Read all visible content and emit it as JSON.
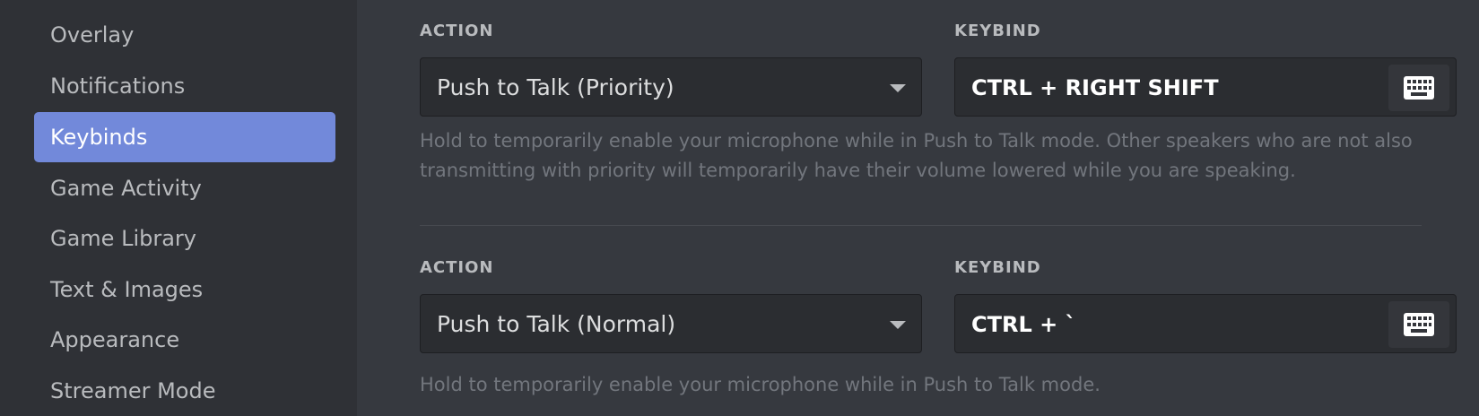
{
  "sidebar": {
    "items": [
      {
        "label": "Overlay",
        "active": false
      },
      {
        "label": "Notifications",
        "active": false
      },
      {
        "label": "Keybinds",
        "active": true
      },
      {
        "label": "Game Activity",
        "active": false
      },
      {
        "label": "Game Library",
        "active": false
      },
      {
        "label": "Text & Images",
        "active": false
      },
      {
        "label": "Appearance",
        "active": false
      },
      {
        "label": "Streamer Mode",
        "active": false
      }
    ]
  },
  "keybinds": [
    {
      "action_label": "ACTION",
      "keybind_label": "KEYBIND",
      "action_value": "Push to Talk (Priority)",
      "keybind_value": "CTRL + RIGHT SHIFT",
      "description": "Hold to temporarily enable your microphone while in Push to Talk mode. Other speakers who are not also transmitting with priority will temporarily have their volume lowered while you are speaking."
    },
    {
      "action_label": "ACTION",
      "keybind_label": "KEYBIND",
      "action_value": "Push to Talk (Normal)",
      "keybind_value": "CTRL + `",
      "description": "Hold to temporarily enable your microphone while in Push to Talk mode."
    }
  ],
  "icons": {
    "dropdown": "chevron-down-icon",
    "keyboard": "keyboard-icon"
  },
  "colors": {
    "accent": "#7289da",
    "sidebar_bg": "#2f3136",
    "main_bg": "#36393f"
  }
}
